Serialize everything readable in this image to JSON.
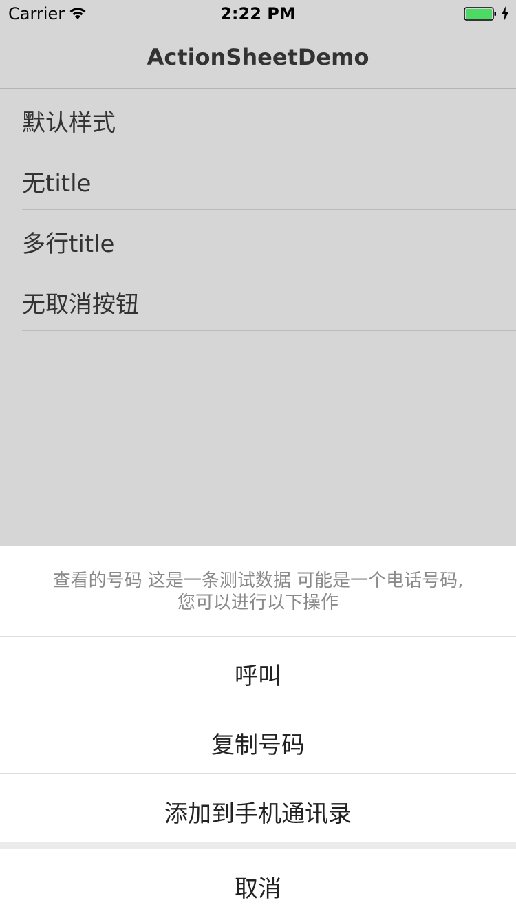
{
  "status_bar": {
    "carrier": "Carrier",
    "time": "2:22 PM",
    "battery_color": "#4cd964"
  },
  "nav": {
    "title": "ActionSheetDemo"
  },
  "list": {
    "items": [
      {
        "label": "默认样式"
      },
      {
        "label": "无title"
      },
      {
        "label": "多行title"
      },
      {
        "label": "无取消按钮"
      }
    ]
  },
  "action_sheet": {
    "title_line1": "查看的号码 这是一条测试数据 可能是一个电话号码,",
    "title_line2": "您可以进行以下操作",
    "actions": [
      {
        "label": "呼叫"
      },
      {
        "label": "复制号码"
      },
      {
        "label": "添加到手机通讯录"
      }
    ],
    "cancel_label": "取消"
  },
  "colors": {
    "background": "#d6d6d6",
    "sheet_background": "#ffffff",
    "title_text": "#8a8a8a"
  }
}
